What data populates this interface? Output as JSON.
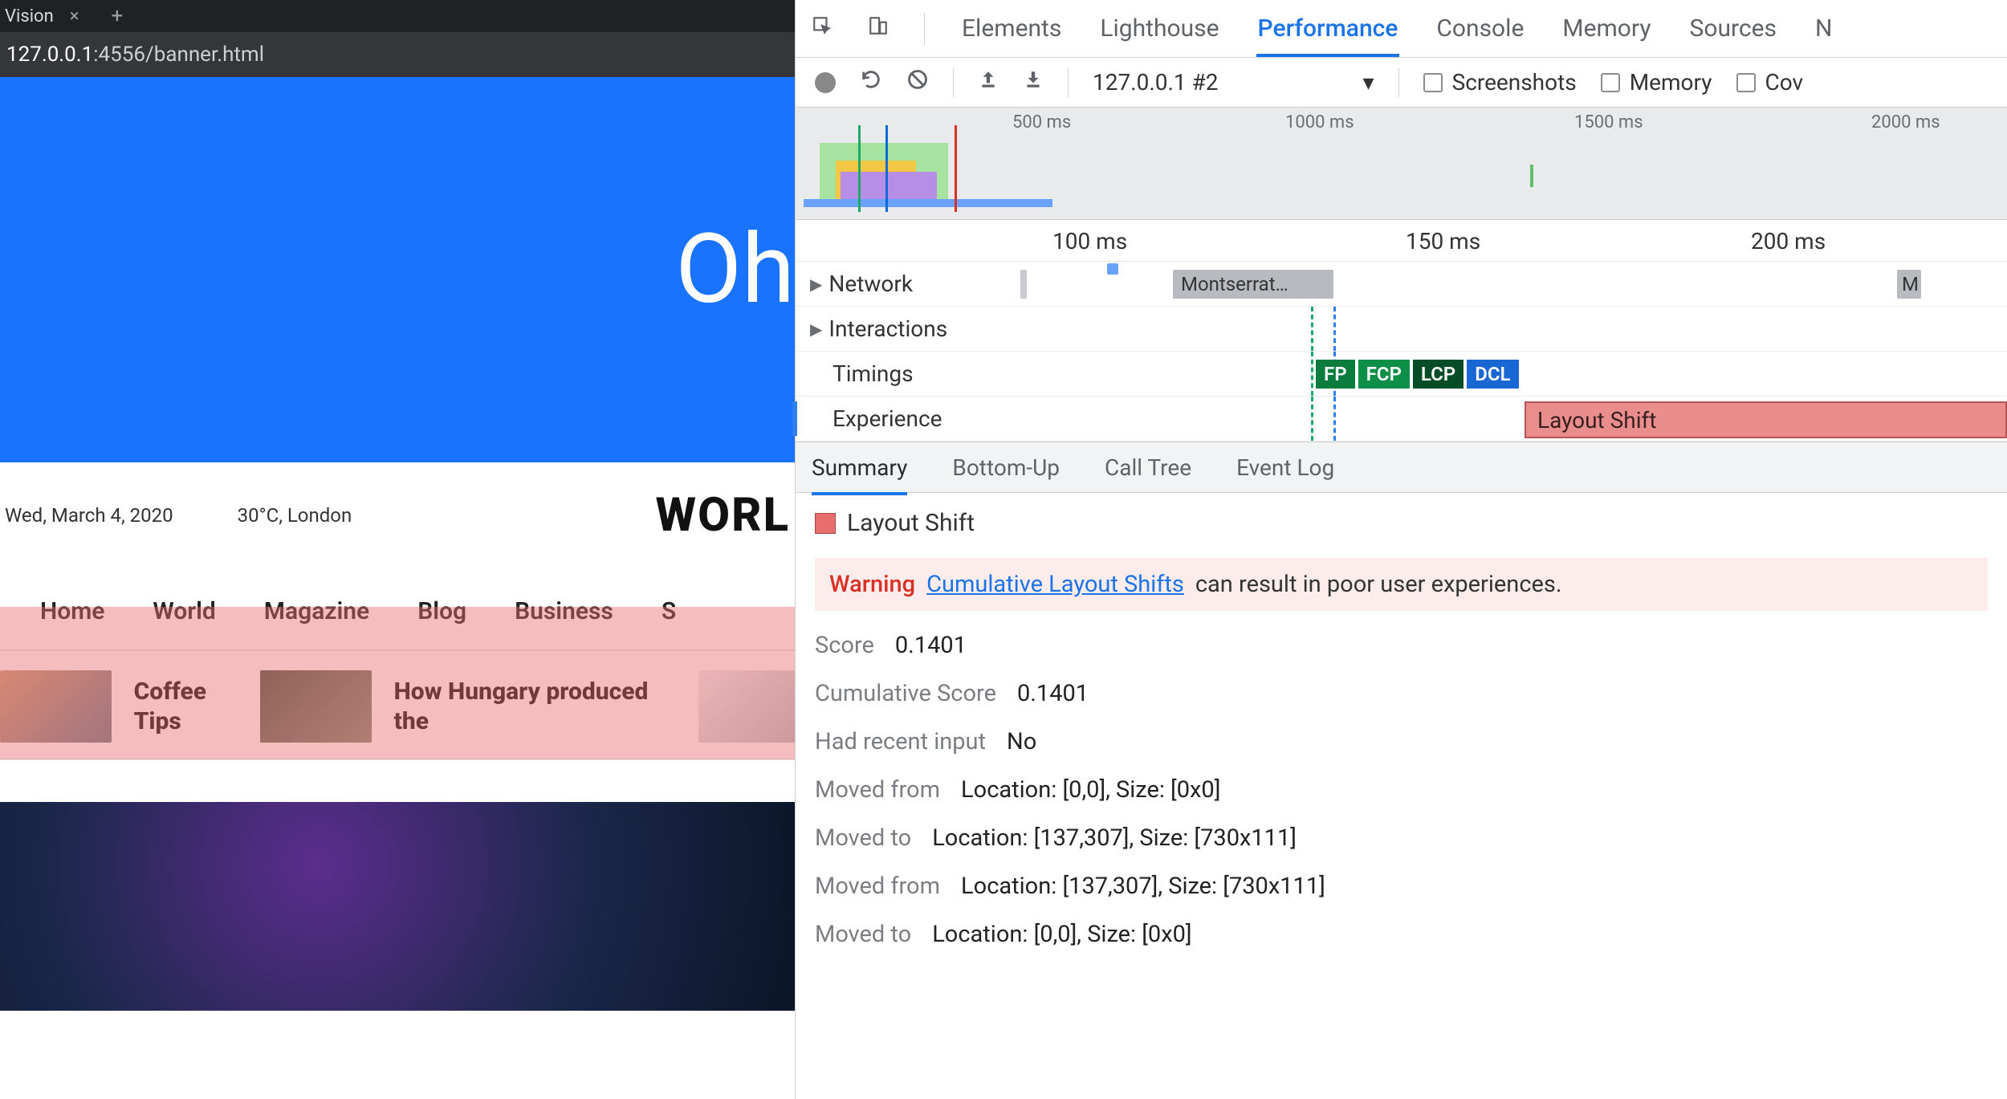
{
  "browser": {
    "tab_title": "Vision",
    "address_host": "127.0.0.1",
    "address_rest": ":4556/banner.html"
  },
  "page": {
    "banner_text": "Oh",
    "date": "Wed, March 4, 2020",
    "weather": "30°C, London",
    "site_title": "WORL",
    "nav": [
      "Home",
      "World",
      "Magazine",
      "Blog",
      "Business",
      "S"
    ],
    "strip": [
      {
        "headline": "Coffee Tips"
      },
      {
        "headline": "How Hungary produced the"
      }
    ]
  },
  "devtools": {
    "tabs": [
      "Elements",
      "Lighthouse",
      "Performance",
      "Console",
      "Memory",
      "Sources",
      "N"
    ],
    "active_tab": "Performance",
    "toolbar": {
      "profile_select": "127.0.0.1 #2",
      "screenshots": "Screenshots",
      "memory": "Memory",
      "cov": "Cov"
    },
    "overview_ticks": [
      "500 ms",
      "1000 ms",
      "1500 ms",
      "2000 ms"
    ],
    "ruler_ticks": [
      "100 ms",
      "150 ms",
      "200 ms"
    ],
    "tracks": {
      "network": "Network",
      "network_item": "Montserrat…",
      "network_item2": "M",
      "interactions": "Interactions",
      "timings": "Timings",
      "experience": "Experience",
      "timing_badges": [
        "FP",
        "FCP",
        "LCP",
        "DCL"
      ],
      "layout_shift_bar": "Layout Shift"
    },
    "subtabs": [
      "Summary",
      "Bottom-Up",
      "Call Tree",
      "Event Log"
    ],
    "active_subtab": "Summary",
    "detail": {
      "title": "Layout Shift",
      "warning_label": "Warning",
      "warning_link": "Cumulative Layout Shifts",
      "warning_rest": "can result in poor user experiences.",
      "rows": [
        {
          "k": "Score",
          "v": "0.1401"
        },
        {
          "k": "Cumulative Score",
          "v": "0.1401"
        },
        {
          "k": "Had recent input",
          "v": "No"
        },
        {
          "k": "Moved from",
          "v": "Location: [0,0], Size: [0x0]"
        },
        {
          "k": "Moved to",
          "v": "Location: [137,307], Size: [730x111]"
        },
        {
          "k": "Moved from",
          "v": "Location: [137,307], Size: [730x111]"
        },
        {
          "k": "Moved to",
          "v": "Location: [0,0], Size: [0x0]"
        }
      ]
    }
  }
}
